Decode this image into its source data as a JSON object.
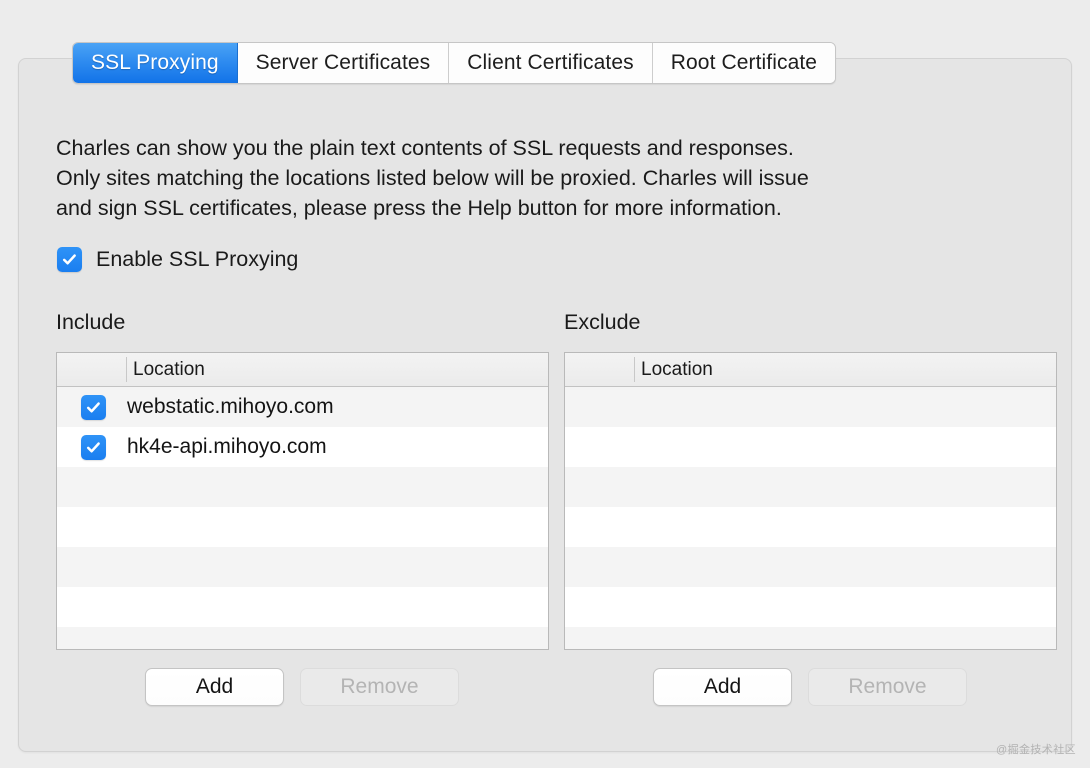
{
  "tabs": [
    {
      "label": "SSL Proxying",
      "active": true
    },
    {
      "label": "Server Certificates",
      "active": false
    },
    {
      "label": "Client Certificates",
      "active": false
    },
    {
      "label": "Root Certificate",
      "active": false
    }
  ],
  "description": {
    "line1": "Charles can show you the plain text contents of SSL requests and responses.",
    "line2": "Only sites matching the locations listed below will be proxied. Charles will issue",
    "line3": "and sign SSL certificates, please press the Help button for more information."
  },
  "enable_ssl": {
    "label": "Enable SSL Proxying",
    "checked": true
  },
  "include": {
    "title": "Include",
    "column_header": "Location",
    "rows": [
      {
        "checked": true,
        "location": "webstatic.mihoyo.com"
      },
      {
        "checked": true,
        "location": "hk4e-api.mihoyo.com"
      }
    ],
    "add_label": "Add",
    "remove_label": "Remove",
    "remove_enabled": false
  },
  "exclude": {
    "title": "Exclude",
    "column_header": "Location",
    "rows": [],
    "add_label": "Add",
    "remove_label": "Remove",
    "remove_enabled": false
  },
  "watermark": "@掘金技术社区",
  "colors": {
    "accent": "#1a7ef0",
    "active_tab_top": "#4aa3f5",
    "active_tab_bottom": "#1273e8",
    "panel_bg": "#e5e5e5",
    "page_bg": "#ececec",
    "row_stripe": "#f4f4f4",
    "disabled_text": "#b4b4b4"
  }
}
